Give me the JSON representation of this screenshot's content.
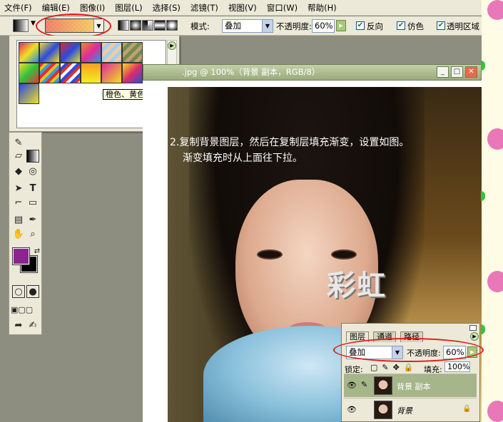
{
  "menubar": {
    "items": [
      {
        "label": "文件(F)"
      },
      {
        "label": "编辑(E)"
      },
      {
        "label": "图像(I)"
      },
      {
        "label": "图层(L)"
      },
      {
        "label": "选择(S)"
      },
      {
        "label": "滤镜(T)"
      },
      {
        "label": "视图(V)"
      },
      {
        "label": "窗口(W)"
      },
      {
        "label": "帮助(H)"
      }
    ]
  },
  "options": {
    "mode_label": "模式:",
    "mode_value": "叠加",
    "opacity_label": "不透明度:",
    "opacity_value": "60%",
    "reverse_label": "反向",
    "dither_label": "仿色",
    "transparency_label": "透明区域"
  },
  "gradient_picker": {
    "tooltip": "橙色、黄色"
  },
  "document": {
    "title": ".jpg @ 100%（背景 副本，RGB/8）",
    "instruction_line1": "2.复制背景图层，然后在复制层填充渐变，设置如图。",
    "instruction_line2": "渐变填充时从上面往下拉。",
    "watermark": "彩虹"
  },
  "layers_panel": {
    "tabs": [
      "图层",
      "通道",
      "路径"
    ],
    "blend_mode": "叠加",
    "opacity_label": "不透明度:",
    "opacity_value": "60%",
    "lock_label": "锁定:",
    "fill_label": "填充:",
    "fill_value": "100%",
    "layers": [
      {
        "name": "背景 副本"
      },
      {
        "name": "背景"
      }
    ]
  },
  "colors": {
    "foreground": "#8c2490",
    "background": "#000000",
    "highlight_circle": "#e21b1b"
  }
}
